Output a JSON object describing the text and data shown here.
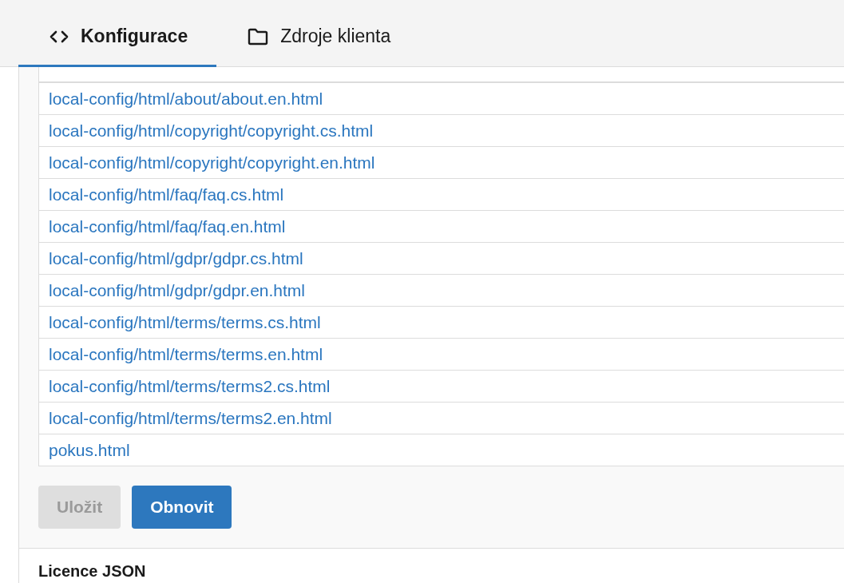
{
  "tabs": [
    {
      "label": "Konfigurace",
      "selected": true
    },
    {
      "label": "Zdroje klienta",
      "selected": false
    }
  ],
  "files": [
    "local-config/html/about/about.en.html",
    "local-config/html/copyright/copyright.cs.html",
    "local-config/html/copyright/copyright.en.html",
    "local-config/html/faq/faq.cs.html",
    "local-config/html/faq/faq.en.html",
    "local-config/html/gdpr/gdpr.cs.html",
    "local-config/html/gdpr/gdpr.en.html",
    "local-config/html/terms/terms.cs.html",
    "local-config/html/terms/terms.en.html",
    "local-config/html/terms/terms2.cs.html",
    "local-config/html/terms/terms2.en.html",
    "pokus.html"
  ],
  "buttons": [
    {
      "label": "Uložit",
      "disabled": true
    },
    {
      "label": "Obnovit",
      "disabled": false
    }
  ],
  "next_section": {
    "title": "Licence JSON"
  }
}
